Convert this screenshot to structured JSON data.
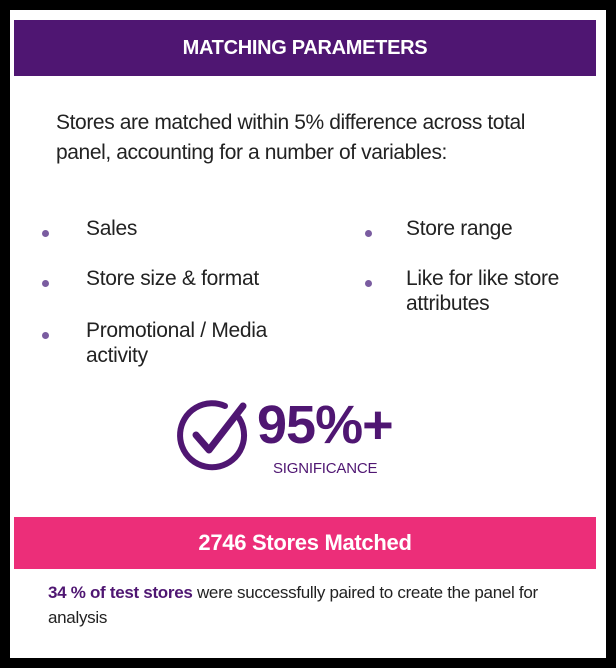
{
  "header": {
    "title": "MATCHING PARAMETERS"
  },
  "intro": {
    "text": "Stores are matched within 5% difference across total panel, accounting for a number of variables:"
  },
  "variables": {
    "left": [
      "Sales",
      "Store size & format",
      "Promotional / Media activity"
    ],
    "right": [
      "Store range",
      "Like for like store attributes"
    ]
  },
  "significance": {
    "value": "95%+",
    "label": "SIGNIFICANCE",
    "icon": "check-circle-icon"
  },
  "stores_matched": {
    "title": "2746 Stores Matched"
  },
  "summary": {
    "highlight": "34 % of test stores",
    "rest": " were successfully paired to create the panel for analysis"
  },
  "colors": {
    "primary": "#4f1672",
    "accent": "#ec2e79",
    "bullet": "#7a5ca0"
  }
}
